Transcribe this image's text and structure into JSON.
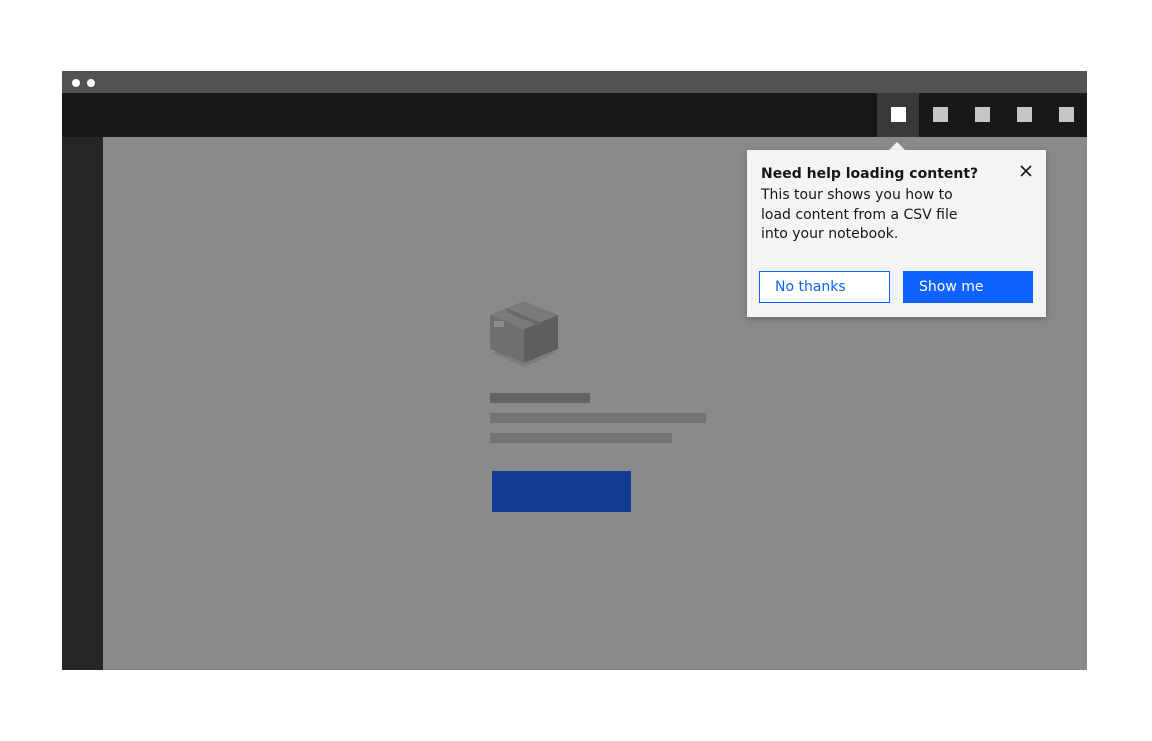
{
  "header": {
    "actions": [
      {
        "icon": "header-action-icon",
        "active": true
      },
      {
        "icon": "header-action-icon",
        "active": false
      },
      {
        "icon": "header-action-icon",
        "active": false
      },
      {
        "icon": "header-action-icon",
        "active": false
      },
      {
        "icon": "header-action-icon",
        "active": false
      }
    ]
  },
  "popover": {
    "title": "Need help loading content?",
    "body": "This tour shows you how to load content from a CSV file into your notebook.",
    "no_thanks_label": "No thanks",
    "show_me_label": "Show me",
    "close_icon": "close-icon"
  },
  "empty_state": {
    "icon": "box-icon"
  },
  "colors": {
    "primary": "#0f62fe",
    "header_bg": "#181818",
    "overlay": "#8a8a8a",
    "popover_bg": "#f4f4f4"
  }
}
